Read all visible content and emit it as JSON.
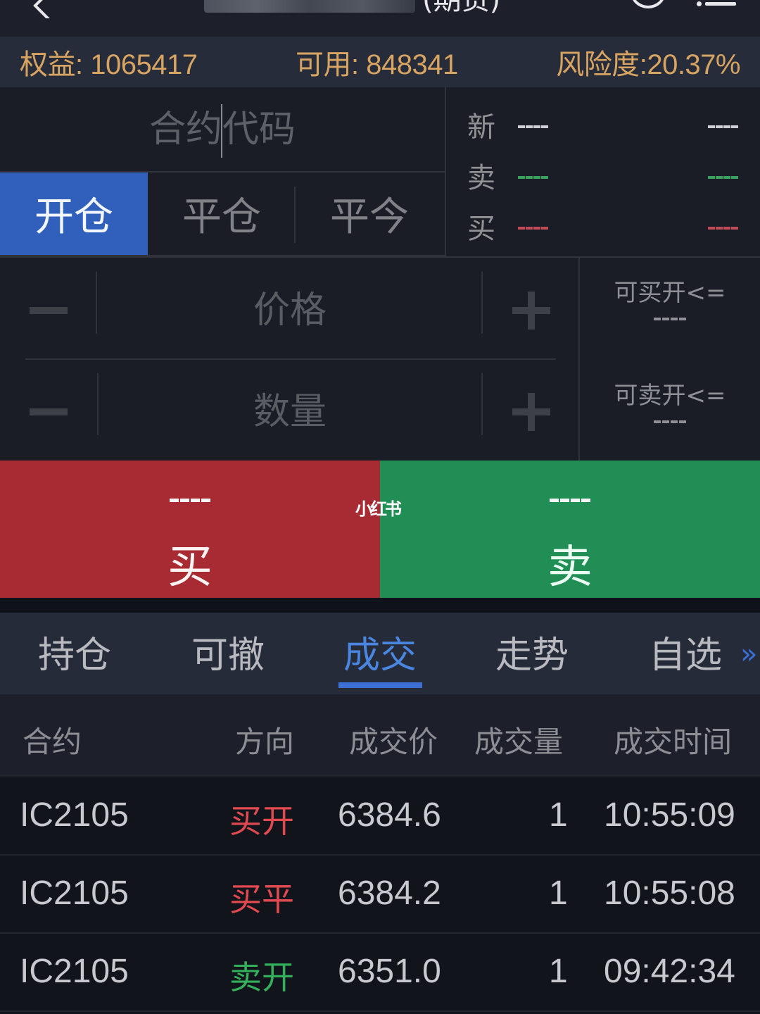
{
  "header": {
    "title_suffix": "(期货)",
    "icons": [
      "back-arrow-icon",
      "refresh-circle-icon",
      "menu-icon"
    ]
  },
  "account": {
    "equity": "权益: 1065417",
    "available": "可用: 848341",
    "risk": "风险度:20.37%"
  },
  "order": {
    "contract_placeholder": "合约代码",
    "offset_tabs": [
      {
        "label": "开仓",
        "active": true
      },
      {
        "label": "平仓",
        "active": false
      },
      {
        "label": "平今",
        "active": false
      }
    ],
    "quote": {
      "rows": [
        {
          "label": "新",
          "left": "----",
          "right": "----",
          "color": "white"
        },
        {
          "label": "卖",
          "left": "----",
          "right": "----",
          "color": "green"
        },
        {
          "label": "买",
          "left": "----",
          "right": "----",
          "color": "red"
        }
      ]
    },
    "price_placeholder": "价格",
    "quantity_placeholder": "数量",
    "can_buy_open_label": "可买开<=",
    "can_buy_open_value": "----",
    "can_sell_open_label": "可卖开<=",
    "can_sell_open_value": "----"
  },
  "trade": {
    "buy_price": "----",
    "buy_label": "买",
    "sell_price": "----",
    "sell_label": "卖",
    "watermark": "小红书"
  },
  "tabs": [
    {
      "label": "持仓",
      "active": false
    },
    {
      "label": "可撤",
      "active": false
    },
    {
      "label": "成交",
      "active": true
    },
    {
      "label": "走势",
      "active": false
    },
    {
      "label": "自选",
      "active": false
    }
  ],
  "more_label": "»",
  "table": {
    "headers": [
      "合约",
      "方向",
      "成交价",
      "成交量",
      "成交时间"
    ],
    "rows": [
      {
        "contract": "IC2105",
        "direction": "买开",
        "side": "buy",
        "price": "6384.6",
        "volume": "1",
        "time": "10:55:09"
      },
      {
        "contract": "IC2105",
        "direction": "买平",
        "side": "buy",
        "price": "6384.2",
        "volume": "1",
        "time": "10:55:08"
      },
      {
        "contract": "IC2105",
        "direction": "卖开",
        "side": "sell",
        "price": "6351.0",
        "volume": "1",
        "time": "09:42:34"
      }
    ]
  },
  "colors": {
    "accent_blue": "#3060bb",
    "buy_red": "#a82a32",
    "sell_green": "#218f55",
    "account_gold": "#d8a462"
  }
}
